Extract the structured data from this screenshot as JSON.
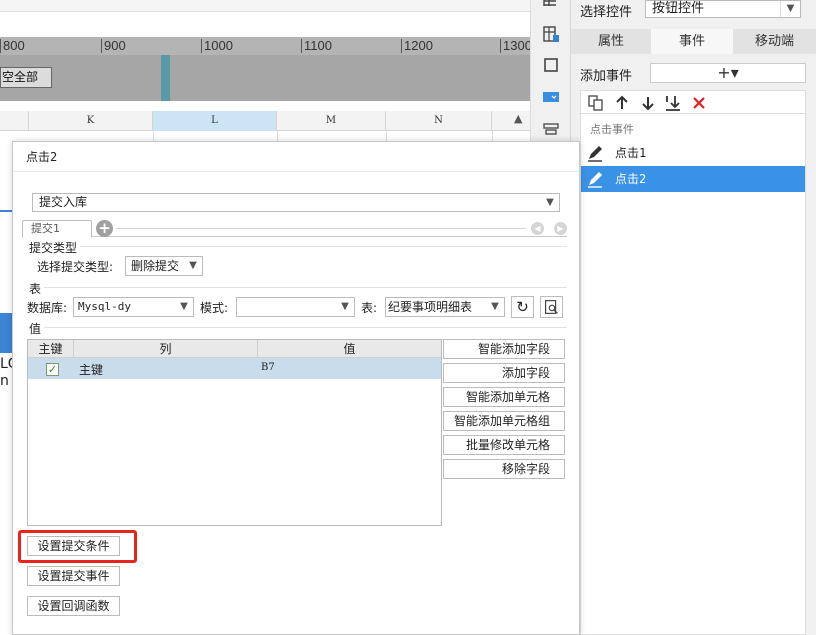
{
  "sheet": {
    "ruler_ticks": [
      "800",
      "900",
      "1000",
      "1100",
      "1200",
      "1300"
    ],
    "clear_all_label": "空全部",
    "columns": [
      "K",
      "L",
      "M",
      "N"
    ],
    "cell_text": "LG\nn"
  },
  "right_panel": {
    "select_control_label": "选择控件",
    "select_control_value": "按钮控件",
    "tabs": [
      "属性",
      "事件",
      "移动端"
    ],
    "add_event_label": "添加事件",
    "add_event_button": "+▾",
    "event_group_label": "点击事件",
    "events": [
      "点击1",
      "点击2"
    ]
  },
  "dialog": {
    "title": "点击2",
    "submit_type": "提交入库",
    "tab_label": "提交1",
    "section_submit_type": "提交类型",
    "select_submit_type_label": "选择提交类型:",
    "select_submit_type_value": "删除提交",
    "section_table": "表",
    "database_label": "数据库:",
    "database_value": "Mysql-dy",
    "mode_label": "模式:",
    "mode_value": "",
    "table_label": "表:",
    "table_value": "纪要事项明细表",
    "section_value": "值",
    "value_table": {
      "headers": [
        "主键",
        "列",
        "值"
      ],
      "rows": [
        {
          "is_key": true,
          "column": "主键",
          "value": "B7"
        }
      ]
    },
    "side_buttons": [
      "智能添加字段",
      "添加字段",
      "智能添加单元格",
      "智能添加单元格组",
      "批量修改单元格",
      "移除字段"
    ],
    "bottom_buttons": [
      "设置提交条件",
      "设置提交事件",
      "设置回调函数"
    ]
  },
  "colors": {
    "accent_selected": "#3a92e6",
    "highlight_red": "#e8241d",
    "row_selected": "#c8dcec"
  }
}
